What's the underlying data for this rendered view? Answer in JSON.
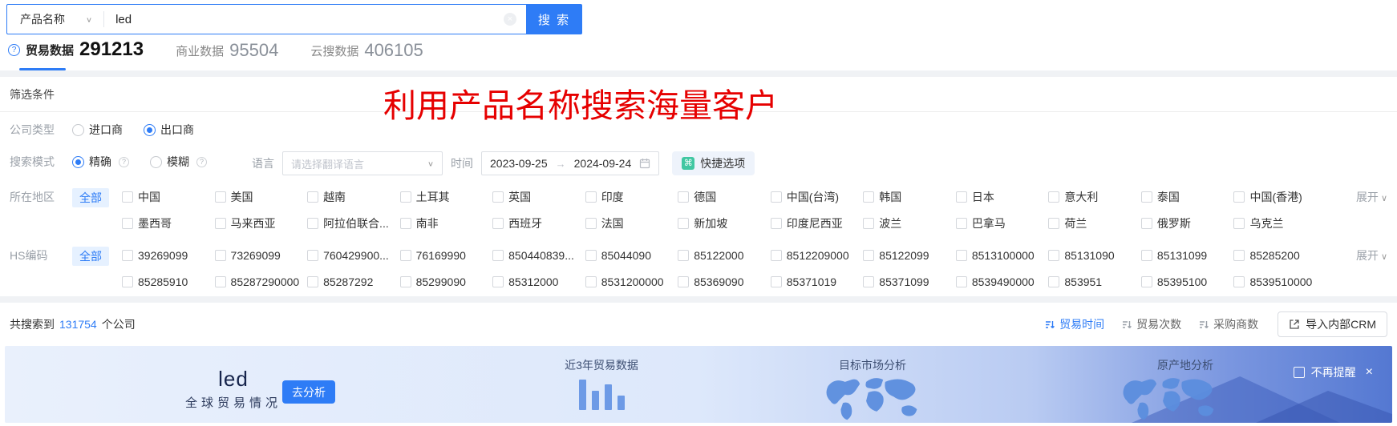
{
  "icons": {
    "question": "?",
    "info": "?",
    "command": "⌘",
    "close": "×",
    "clear": "×",
    "chevron": "∨",
    "arrow": "→"
  },
  "search": {
    "category": "产品名称",
    "query": "led",
    "button": "搜 索"
  },
  "tabs": [
    {
      "label": "贸易数据",
      "count": "291213",
      "active": true
    },
    {
      "label": "商业数据",
      "count": "95504",
      "active": false
    },
    {
      "label": "云搜数据",
      "count": "406105",
      "active": false
    }
  ],
  "overlay_title": "利用产品名称搜索海量客户",
  "filters": {
    "title": "筛选条件",
    "company_type": {
      "label": "公司类型",
      "options": [
        {
          "label": "进口商",
          "active": false
        },
        {
          "label": "出口商",
          "active": true
        }
      ]
    },
    "search_mode": {
      "label": "搜索模式",
      "options": [
        {
          "label": "精确",
          "active": true
        },
        {
          "label": "模糊",
          "active": false
        }
      ]
    },
    "language": {
      "label": "语言",
      "placeholder": "请选择翻译语言"
    },
    "time": {
      "label": "时间",
      "start": "2023-09-25",
      "end": "2024-09-24"
    },
    "quick_option": "快捷选项",
    "region": {
      "label": "所在地区",
      "all": "全部",
      "expand": "展开",
      "row1": [
        "中国",
        "美国",
        "越南",
        "土耳其",
        "英国",
        "印度",
        "德国",
        "中国(台湾)",
        "韩国",
        "日本",
        "意大利",
        "泰国",
        "中国(香港)"
      ],
      "row2": [
        "墨西哥",
        "马来西亚",
        "阿拉伯联合...",
        "南非",
        "西班牙",
        "法国",
        "新加坡",
        "印度尼西亚",
        "波兰",
        "巴拿马",
        "荷兰",
        "俄罗斯",
        "乌克兰"
      ]
    },
    "hs_code": {
      "label": "HS编码",
      "all": "全部",
      "expand": "展开",
      "row1": [
        "39269099",
        "73269099",
        "760429900...",
        "76169990",
        "850440839...",
        "85044090",
        "85122000",
        "8512209000",
        "85122099",
        "8513100000",
        "85131090",
        "85131099",
        "85285200"
      ],
      "row2": [
        "85285910",
        "85287290000",
        "85287292",
        "85299090",
        "85312000",
        "8531200000",
        "85369090",
        "85371019",
        "85371099",
        "8539490000",
        "853951",
        "85395100",
        "8539510000"
      ]
    }
  },
  "results": {
    "prefix": "共搜索到",
    "count": "131754",
    "suffix": "个公司",
    "sorts": [
      {
        "label": "贸易时间",
        "active": true
      },
      {
        "label": "贸易次数",
        "active": false
      },
      {
        "label": "采购商数",
        "active": false
      }
    ],
    "crm_button": "导入内部CRM"
  },
  "banner": {
    "keyword": "led",
    "subtitle": "全球贸易情况",
    "analyze_button": "去分析",
    "sections": [
      "近3年贸易数据",
      "目标市场分析",
      "原产地分析"
    ],
    "dismiss": "不再提醒"
  },
  "colors": {
    "primary": "#2e7cf6",
    "red": "#e60000",
    "accent_green": "#41c7a2"
  }
}
